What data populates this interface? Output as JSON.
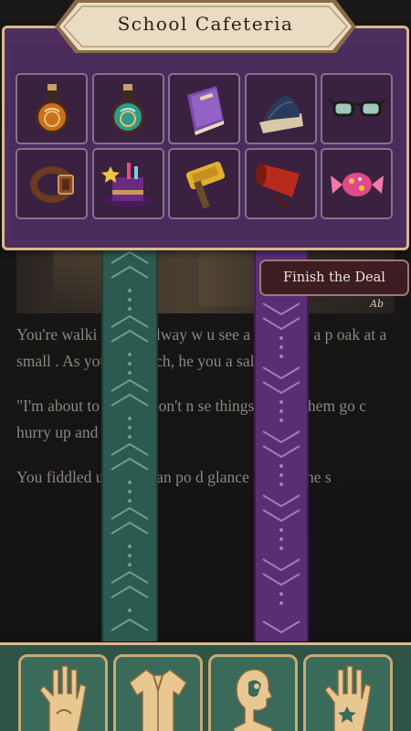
{
  "header": {
    "title": "School Cafeteria"
  },
  "inventory": {
    "items": [
      {
        "name": "orange-potion"
      },
      {
        "name": "teal-potion"
      },
      {
        "name": "purple-book"
      },
      {
        "name": "wizard-hat"
      },
      {
        "name": "spectacles"
      },
      {
        "name": "leather-belt"
      },
      {
        "name": "magic-top-hat"
      },
      {
        "name": "golden-hammer"
      },
      {
        "name": "red-megaphone"
      },
      {
        "name": "pink-candy"
      }
    ]
  },
  "actions": {
    "finish_label": "Finish the Deal"
  },
  "illustration": {
    "signature": "Ab"
  },
  "story": {
    "p1": "You're walki       n the hallway w       u see a senior in a p        oak at a small      . As you approach, he         you a salesma         e.",
    "p2": "\"I'm about to      te, so I don't n        se things. I'll let them go c         hurry up and       me!\"",
    "p3": "You fiddled        ur jellybean po        d glance around the s"
  },
  "bottom_bar": {
    "buttons": [
      {
        "name": "palm-hand-icon"
      },
      {
        "name": "shirt-icon"
      },
      {
        "name": "head-profile-icon"
      },
      {
        "name": "open-hand-icon"
      }
    ]
  },
  "colors": {
    "panel_purple": "#4d2e5e",
    "gold_trim": "#d9b98a",
    "banner_green": "#2d5a50",
    "banner_purple": "#5a2e72",
    "action_green": "#3a6a5a"
  }
}
